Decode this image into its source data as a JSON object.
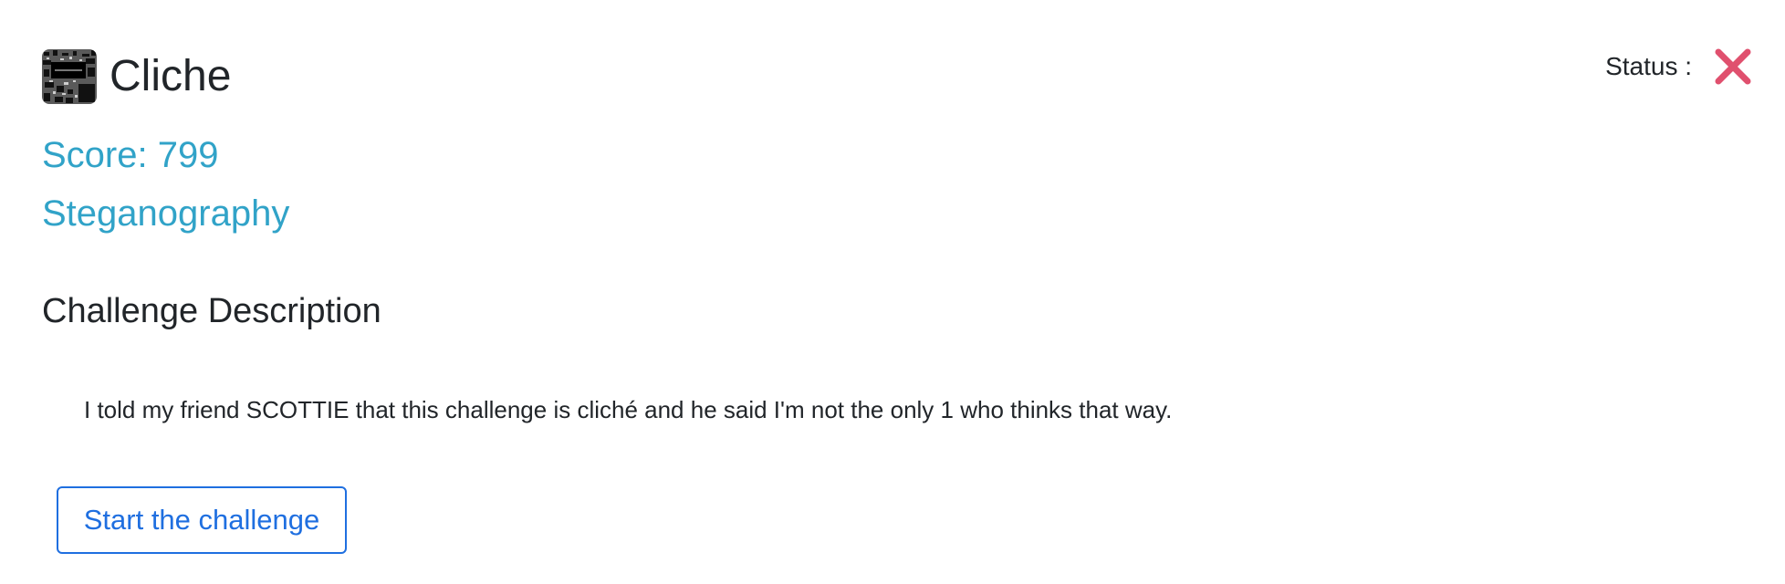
{
  "challenge": {
    "title": "Cliche",
    "icon": "challenge-thumbnail-icon",
    "score": "Score: 799",
    "category": "Steganography"
  },
  "status": {
    "label": "Status :",
    "icon": "close-x-icon",
    "color": "#e0506e"
  },
  "description": {
    "heading": "Challenge Description",
    "text": "I told my friend SCOTTIE that this challenge is cliché and he said I'm not the only 1 who thinks that way."
  },
  "actions": {
    "start_label": "Start the challenge"
  },
  "colors": {
    "accent_teal": "#31a3c8",
    "button_blue": "#1f6fe0",
    "text_dark": "#212529"
  }
}
